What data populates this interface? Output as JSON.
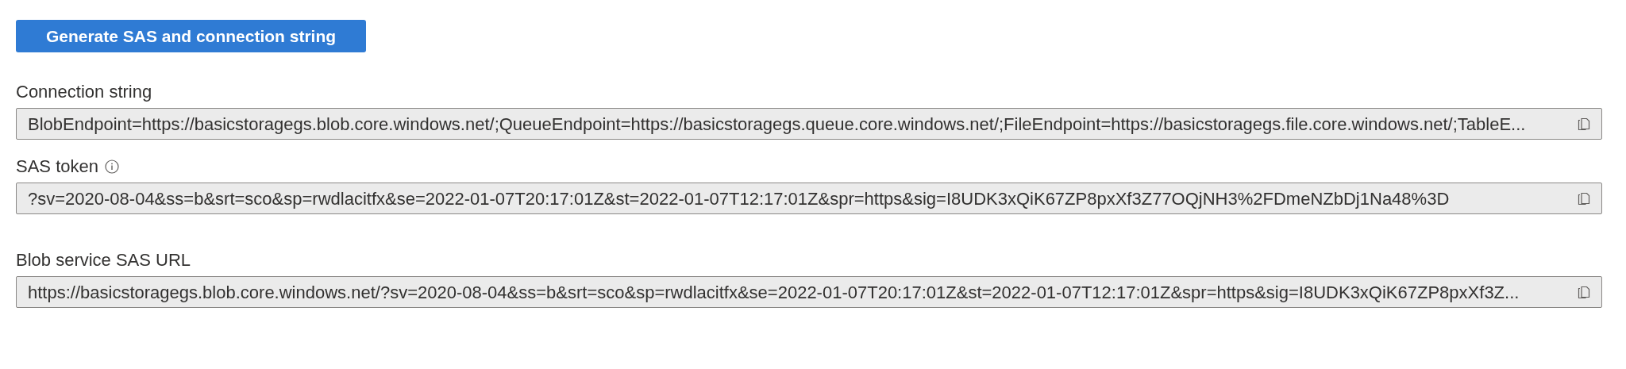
{
  "button": {
    "label": "Generate SAS and connection string"
  },
  "fields": [
    {
      "label": "Connection string",
      "info": false,
      "value": "BlobEndpoint=https://basicstoragegs.blob.core.windows.net/;QueueEndpoint=https://basicstoragegs.queue.core.windows.net/;FileEndpoint=https://basicstoragegs.file.core.windows.net/;TableE..."
    },
    {
      "label": "SAS token",
      "info": true,
      "value": "?sv=2020-08-04&ss=b&srt=sco&sp=rwdlacitfx&se=2022-01-07T20:17:01Z&st=2022-01-07T12:17:01Z&spr=https&sig=I8UDK3xQiK67ZP8pxXf3Z77OQjNH3%2FDmeNZbDj1Na48%3D"
    },
    {
      "label": "Blob service SAS URL",
      "info": false,
      "value": "https://basicstoragegs.blob.core.windows.net/?sv=2020-08-04&ss=b&srt=sco&sp=rwdlacitfx&se=2022-01-07T20:17:01Z&st=2022-01-07T12:17:01Z&spr=https&sig=I8UDK3xQiK67ZP8pxXf3Z..."
    }
  ]
}
